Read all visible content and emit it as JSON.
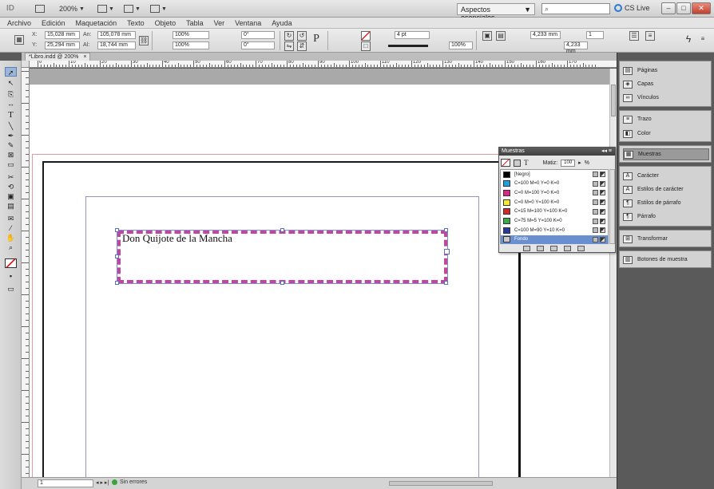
{
  "app": {
    "logo": "ID",
    "zoom": "200%",
    "workspace": "Aspectos esenciales",
    "cslive": "CS Live",
    "window_buttons": [
      "–",
      "□",
      "✕"
    ]
  },
  "menu": [
    "Archivo",
    "Edición",
    "Maquetación",
    "Texto",
    "Objeto",
    "Tabla",
    "Ver",
    "Ventana",
    "Ayuda"
  ],
  "control": {
    "x_label": "X:",
    "x_value": "15,028 mm",
    "y_label": "Y:",
    "y_value": "25,294 mm",
    "w_label": "An:",
    "w_value": "105,078 mm",
    "h_label": "Al:",
    "h_value": "18,744 mm",
    "scale_x": "100%",
    "scale_y": "100%",
    "angle": "0°",
    "shear": "0°",
    "stroke_weight": "4 pt",
    "opacity": "100%",
    "offset_1": "4,233 mm",
    "offset_2": "4,233 mm",
    "columns": "1"
  },
  "document": {
    "tab_title": "*Libro.indd @ 200%",
    "tab_close": "×"
  },
  "ruler": {
    "labels": [
      "0",
      "10",
      "20",
      "30",
      "40",
      "50",
      "60",
      "70",
      "80",
      "90",
      "100",
      "110",
      "120",
      "130",
      "140",
      "150",
      "160",
      "170"
    ]
  },
  "text_frame": {
    "content": "Don Quijote de la Mancha"
  },
  "status": {
    "page": "1",
    "nav": "◂ ▸ ▸|",
    "preflight": "Sin errores"
  },
  "dock": {
    "group1": [
      {
        "icon": "pages-icon",
        "label": "Páginas"
      },
      {
        "icon": "layers-icon",
        "label": "Capas"
      },
      {
        "icon": "links-icon",
        "label": "Vínculos"
      }
    ],
    "group2": [
      {
        "icon": "stroke-icon",
        "label": "Trazo"
      },
      {
        "icon": "color-icon",
        "label": "Color"
      }
    ],
    "group3": [
      {
        "icon": "swatches-icon",
        "label": "Muestras"
      }
    ],
    "group4": [
      {
        "icon": "character-icon",
        "label": "Carácter"
      },
      {
        "icon": "char-styles-icon",
        "label": "Estilos de carácter"
      },
      {
        "icon": "para-styles-icon",
        "label": "Estilos de párrafo"
      },
      {
        "icon": "paragraph-icon",
        "label": "Párrafo"
      }
    ],
    "group5": [
      {
        "icon": "transform-icon",
        "label": "Transformar"
      }
    ],
    "group6": [
      {
        "icon": "sample-buttons-icon",
        "label": "Botones de muestra"
      }
    ]
  },
  "swatches_panel": {
    "title": "Muestras",
    "tint_label": "Matiz:",
    "tint_value": "100",
    "tint_unit": "%",
    "rows": [
      {
        "name": "[Negro]",
        "color": "#000000"
      },
      {
        "name": "C=100 M=0 Y=0 K=0",
        "color": "#1aa3e0"
      },
      {
        "name": "C=0 M=100 Y=0 K=0",
        "color": "#e0238a"
      },
      {
        "name": "C=0 M=0 Y=100 K=0",
        "color": "#f7ea2a"
      },
      {
        "name": "C=15 M=100 Y=100 K=0",
        "color": "#cf2a2a"
      },
      {
        "name": "C=75 M=5 Y=100 K=0",
        "color": "#3aa94a"
      },
      {
        "name": "C=100 M=90 Y=10 K=0",
        "color": "#2a3a96"
      },
      {
        "name": "Fondo",
        "color": "#c8c8c8"
      }
    ],
    "selected": "Fondo"
  },
  "colors": {
    "frame_stroke": "#c2469e",
    "selection": "#5a6ec8",
    "bleed": "#e39ba3",
    "panel_selection": "#6a8fd0"
  }
}
